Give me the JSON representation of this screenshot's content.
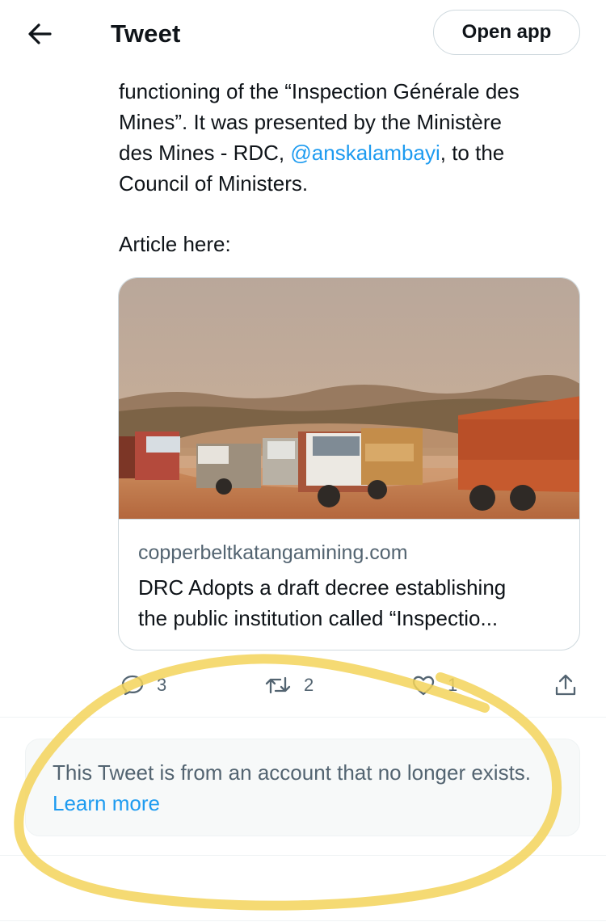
{
  "header": {
    "title": "Tweet",
    "open_app_label": "Open app",
    "back_icon": "arrow-left-icon"
  },
  "tweet": {
    "lines": [
      "functioning of the “Inspection Générale des",
      "Mines”. It was presented by the Ministère"
    ],
    "line3_before": "des Mines - RDC, ",
    "mention": "@anskalambayi",
    "line3_after": ", to the",
    "line4": "Council of Ministers.",
    "article_label": "Article here:"
  },
  "card": {
    "domain": "copperbeltkatangamining.com",
    "title_line1": "DRC Adopts a draft decree establishing",
    "title_line2": "the public institution called “Inspectio..."
  },
  "actions": {
    "reply_count": "3",
    "retweet_count": "2",
    "like_count": "1",
    "icons": [
      "reply-icon",
      "retweet-icon",
      "like-icon",
      "share-icon"
    ]
  },
  "notice": {
    "text": "This Tweet is from an account that no longer exists. ",
    "link": "Learn more"
  },
  "colors": {
    "accent": "#1d9bf0",
    "secondary_text": "#536471",
    "highlight": "#f3d35b"
  }
}
